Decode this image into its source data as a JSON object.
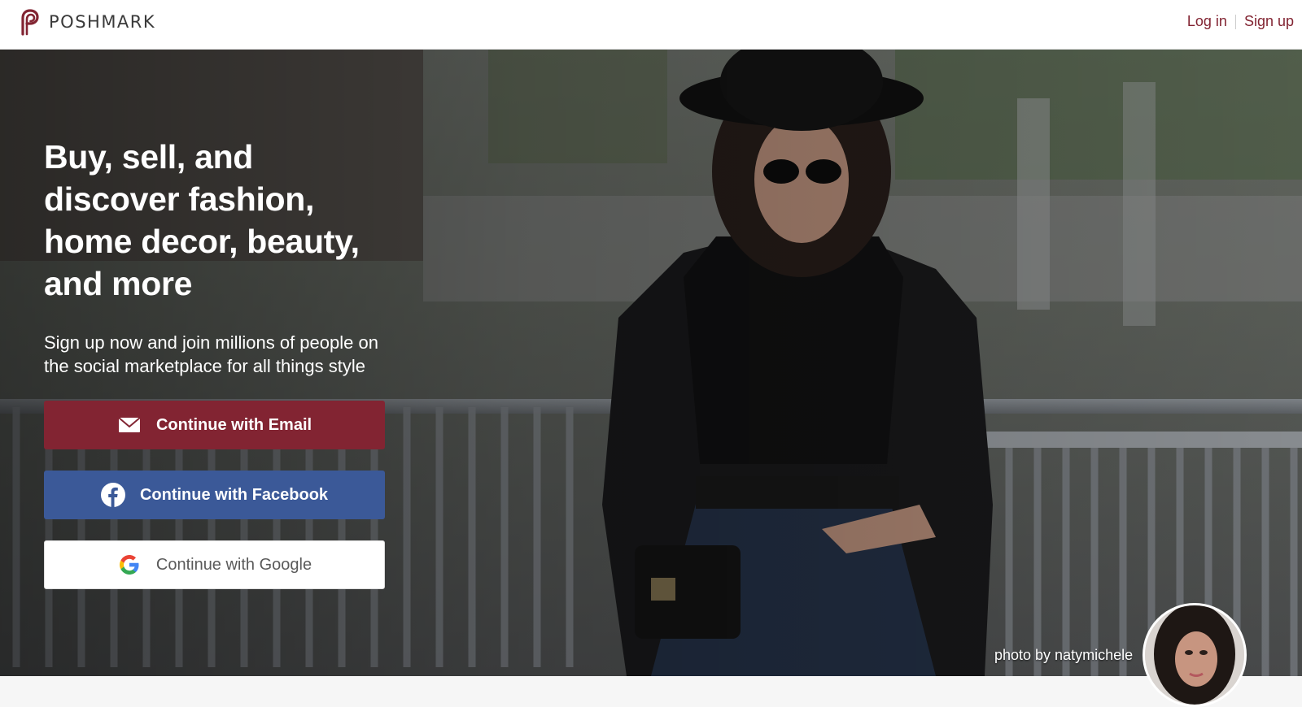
{
  "brand": {
    "name": "POSHMARK",
    "color": "#822432"
  },
  "header": {
    "login_label": "Log in",
    "signup_label": "Sign up"
  },
  "hero": {
    "title": "Buy, sell, and discover fashion, home decor, beauty, and more",
    "subtitle": "Sign up now and join millions of people on the social marketplace for all things style",
    "buttons": {
      "email_label": "Continue with Email",
      "email_icon": "envelope-icon",
      "email_color": "#822432",
      "facebook_label": "Continue with Facebook",
      "facebook_icon": "facebook-icon",
      "facebook_color": "#3b5998",
      "google_label": "Continue with Google",
      "google_icon": "google-icon"
    },
    "photo_credit": "photo by natymichele"
  }
}
